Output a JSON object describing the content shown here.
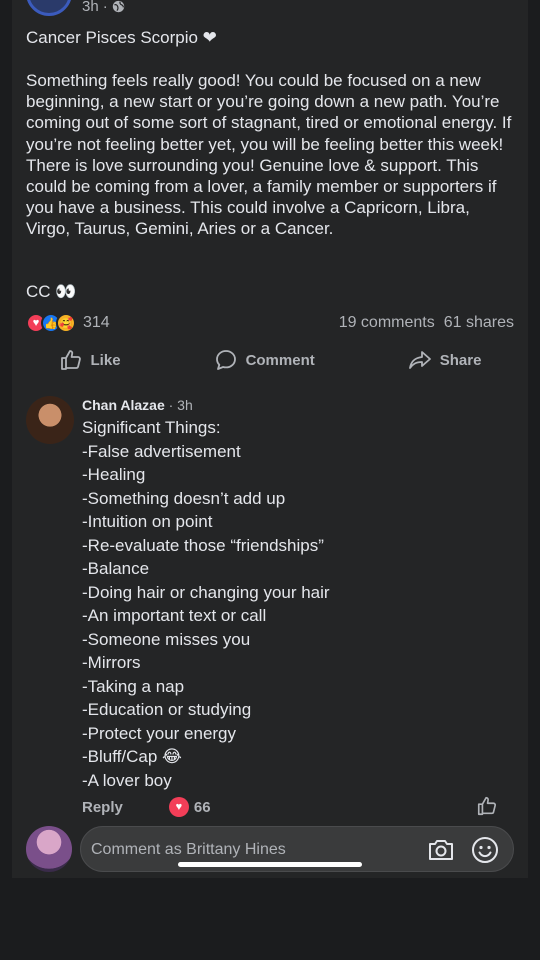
{
  "post": {
    "time": "3h",
    "visibility_sep": "·",
    "title": "Cancer Pisces Scorpio ❤",
    "body": "Something feels really good! You could be focused on a new beginning, a new start or you’re going down a new path. You’re coming out of some sort of stagnant, tired or emotional energy. If you’re not feeling better yet, you will be feeling better this week! There is love surrounding you! Genuine love & support. This could be coming from a lover, a family member or supporters if you have a business. This could involve a Capricorn, Libra, Virgo, Taurus, Gemini, Aries or a Cancer.",
    "signature": "CC 👀",
    "reaction_count": "314",
    "comments": "19 comments",
    "shares": "61 shares"
  },
  "actions": {
    "like": "Like",
    "comment": "Comment",
    "share": "Share"
  },
  "comment": {
    "author": "Chan Alazae",
    "time": "· 3h",
    "lines": [
      "Significant Things:",
      "-False advertisement",
      "-Healing",
      "-Something doesn’t add up",
      "-Intuition on point",
      "-Re-evaluate those “friendships”",
      "-Balance",
      "-Doing hair or changing your hair",
      "-An important text or call",
      "-Someone misses you",
      "-Mirrors",
      "-Taking a nap",
      "-Education or studying",
      "-Protect your energy",
      "-Bluff/Cap 😂",
      "-A lover boy"
    ],
    "reply_label": "Reply",
    "like_count": "66"
  },
  "composer": {
    "placeholder": "Comment as Brittany Hines"
  },
  "colors": {
    "card": "#242526",
    "text": "#e4e6eb",
    "muted": "#b0b3b8",
    "love": "#f33e58",
    "like": "#1877f2"
  }
}
